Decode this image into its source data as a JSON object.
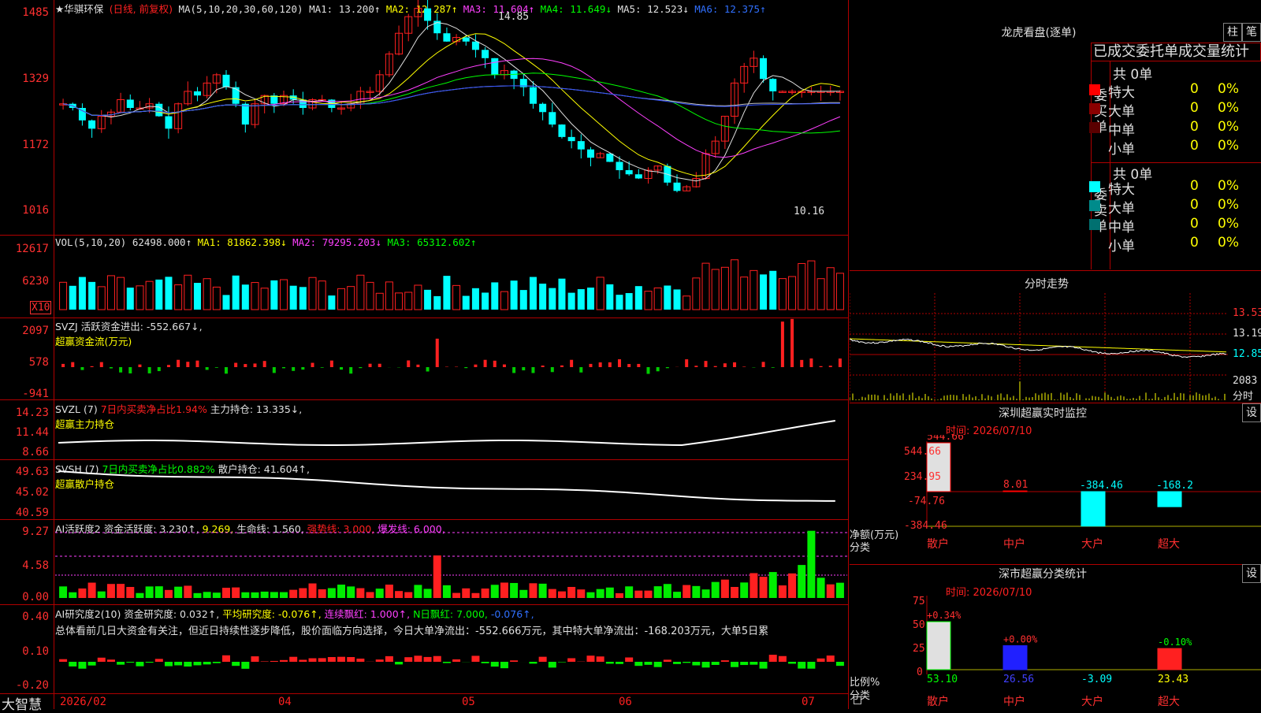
{
  "app": {
    "brand": "大智慧"
  },
  "kline": {
    "title": "★华骐环保",
    "period": "(日线, 前复权)",
    "ma_params": "MA(5,10,20,30,60,120)",
    "ma1": "MA1: 13.200↑",
    "ma2": "MA2: 12.287↑",
    "ma3": "MA3: 11.604↑",
    "ma4": "MA4: 11.649↓",
    "ma5": "MA5: 12.523↓",
    "ma6": "MA6: 12.375↑",
    "y_ticks": [
      "1485",
      "1329",
      "1172",
      "1016"
    ],
    "high_label": "14.85",
    "low_label": "10.16",
    "colors": {
      "up": "#ff2020",
      "down": "#00ffff"
    }
  },
  "volume": {
    "name": "VOL(5,10,20)",
    "value": "62498.000↑",
    "ma1": "MA1: 81862.398↓",
    "ma2": "MA2: 79295.203↓",
    "ma3": "MA3: 65312.602↑",
    "y_ticks": [
      "12617",
      "6230"
    ],
    "unit": "X10"
  },
  "svzj": {
    "line1": "SVZJ  活跃资金进出: -552.667↓,",
    "line2": "超赢资金流(万元)",
    "y_ticks": [
      "2097",
      "578",
      "-941"
    ]
  },
  "svzl": {
    "name": "SVZL (7)",
    "pct": "7日内买卖净占比1.94%",
    "hold": "主力持仓: 13.335↓,",
    "line2": "超赢主力持仓",
    "y_ticks": [
      "14.23",
      "11.44",
      "8.66"
    ]
  },
  "svsh": {
    "name": "SVSH (7)",
    "pct": "7日内买卖净占比0.882%",
    "hold": "散户持仓: 41.604↑,",
    "line2": "超赢散户持仓",
    "y_ticks": [
      "49.63",
      "45.02",
      "40.59"
    ]
  },
  "ai_active": {
    "name": "AI活跃度2",
    "v1": "资金活跃度: 3.230↑,",
    "v2": "9.269,",
    "v3": "生命线: 1.560,",
    "v4": "强势线: 3.000,",
    "v5": "爆发线: 6.000,",
    "y_ticks": [
      "9.27",
      "4.58",
      "0.00"
    ]
  },
  "ai_research": {
    "name": "AI研究度2(10)",
    "v1": "资金研究度: 0.032↑,",
    "v2": "平均研究度: -0.076↑,",
    "v3": "连续飘红: 1.000↑,",
    "v4": "N日飘红: 7.000,",
    "v5": "-0.076↑,",
    "summary": "总体看前几日大资金有关注，但近日持续性逐步降低，股价面临方向选择，今日大单净流出：-552.666万元，其中特大单净流出：-168.203万元，大单5日累",
    "y_ticks": [
      "0.40",
      "0.10",
      "-0.20"
    ]
  },
  "x_axis": [
    "2026/02",
    "04",
    "05",
    "06",
    "07"
  ],
  "lhb": {
    "title": "龙虎看盘(逐单)",
    "btn1": "柱",
    "btn2": "笔",
    "header": "已成交委托单成交量统计",
    "buy_label": "委买单",
    "sell_label": "委卖单",
    "buy_total": "共 0单",
    "sell_total": "共 0单",
    "buy_rows": [
      {
        "name": "特大",
        "count": "0",
        "pct": "0%",
        "color": "#ff0000"
      },
      {
        "name": "大单",
        "count": "0",
        "pct": "0%",
        "color": "#8b0000"
      },
      {
        "name": "中单",
        "count": "0",
        "pct": "0%",
        "color": "#5a0000"
      },
      {
        "name": "小单",
        "count": "0",
        "pct": "0%",
        "color": ""
      }
    ],
    "sell_rows": [
      {
        "name": "特大",
        "count": "0",
        "pct": "0%",
        "color": "#00ffff"
      },
      {
        "name": "大单",
        "count": "0",
        "pct": "0%",
        "color": "#008b8b"
      },
      {
        "name": "中单",
        "count": "0",
        "pct": "0%",
        "color": "#007070"
      },
      {
        "name": "小单",
        "count": "0",
        "pct": "0%",
        "color": ""
      }
    ]
  },
  "intraday": {
    "title": "分时走势",
    "prices": [
      "13.53",
      "13.19",
      "12.85"
    ],
    "vol": "2083",
    "vol_unit": "分时"
  },
  "monitor": {
    "title": "深圳超赢实时监控",
    "btn": "设",
    "time": "时间: 2026/07/10",
    "y_ticks": [
      "544.66",
      "234.95",
      "-74.76",
      "-384.46"
    ],
    "y_label": "净额(万元)",
    "x_label": "分类",
    "categories": [
      "散户",
      "中户",
      "大户",
      "超大"
    ],
    "values": [
      544.66,
      8.01,
      -384.46,
      -168.2
    ],
    "value_labels": [
      "544.66",
      "8.01",
      "-384.46",
      "-168.2"
    ]
  },
  "classify": {
    "title": "深市超赢分类统计",
    "btn": "设",
    "time": "时间: 2026/07/10",
    "y_ticks": [
      "75",
      "50",
      "25",
      "0"
    ],
    "y_label": "比例%",
    "x_label": "分类",
    "categories": [
      "散户",
      "中户",
      "大户",
      "超大"
    ],
    "pct": [
      53.1,
      26.56,
      -3.09,
      23.43
    ],
    "pct_labels": [
      "53.10",
      "26.56",
      "-3.09",
      "23.43"
    ],
    "chg_labels": [
      "+0.34%",
      "+0.00%",
      "",
      "-0.10%"
    ]
  }
}
